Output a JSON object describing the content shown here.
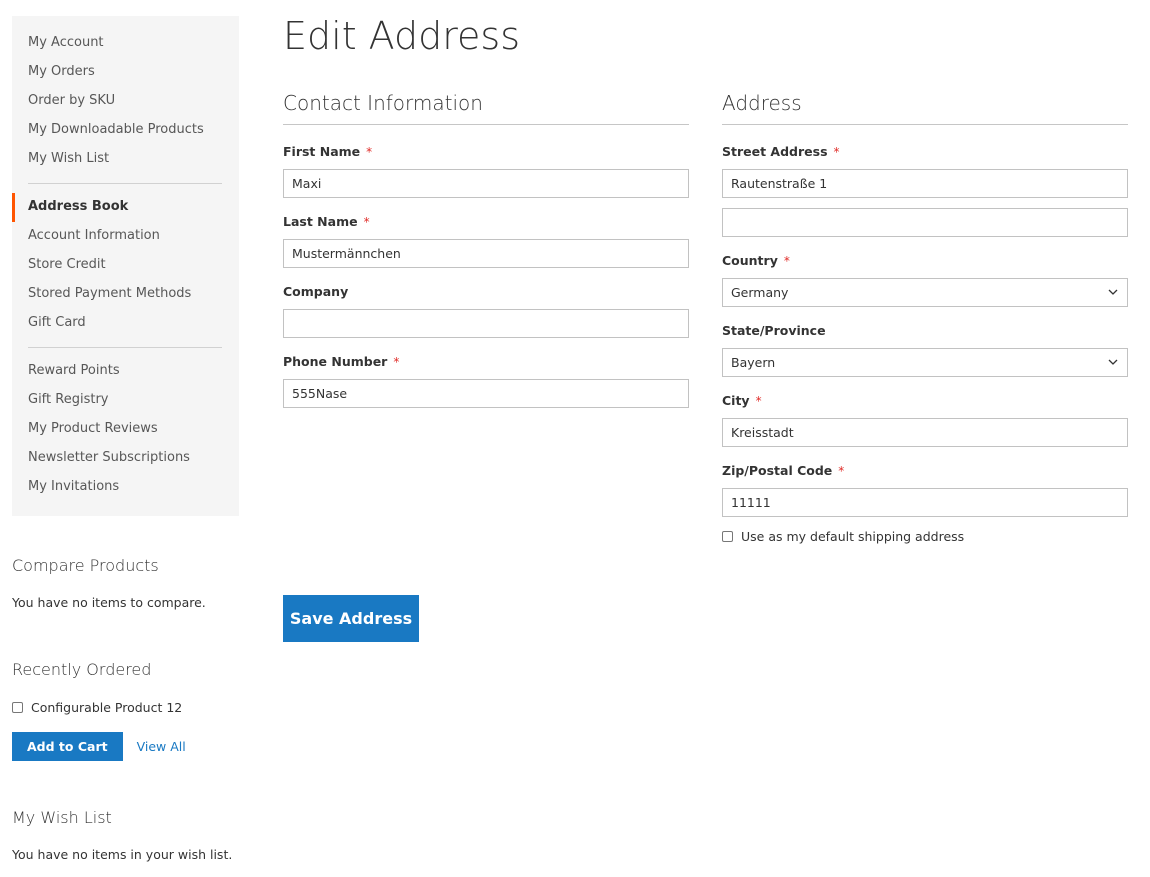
{
  "sidebar": {
    "group1": [
      "My Account",
      "My Orders",
      "Order by SKU",
      "My Downloadable Products",
      "My Wish List"
    ],
    "group2": [
      "Address Book",
      "Account Information",
      "Store Credit",
      "Stored Payment Methods",
      "Gift Card"
    ],
    "group3": [
      "Reward Points",
      "Gift Registry",
      "My Product Reviews",
      "Newsletter Subscriptions",
      "My Invitations"
    ],
    "current": "Address Book",
    "current_color": "#ff5501"
  },
  "compare": {
    "title": "Compare Products",
    "empty_text": "You have no items to compare."
  },
  "recent": {
    "title": "Recently Ordered",
    "item": "Configurable Product 12",
    "add_to_cart": "Add to Cart",
    "view_all": "View All"
  },
  "wishlist": {
    "title": "My Wish List",
    "empty_text": "You have no items in your wish list."
  },
  "page": {
    "title": "Edit Address"
  },
  "contact": {
    "legend": "Contact Information",
    "first_name_label": "First Name",
    "first_name_value": "Maxi",
    "last_name_label": "Last Name",
    "last_name_value": "Mustermännchen",
    "company_label": "Company",
    "company_value": "",
    "phone_label": "Phone Number",
    "phone_value": "555Nase"
  },
  "address": {
    "legend": "Address",
    "street_label": "Street Address",
    "street_line1": "Rautenstraße 1",
    "street_line2": "",
    "country_label": "Country",
    "country_value": "Germany",
    "state_label": "State/Province",
    "state_value": "Bayern",
    "city_label": "City",
    "city_value": "Kreisstadt",
    "zip_label": "Zip/Postal Code",
    "zip_value": "11111",
    "default_shipping_label": "Use as my default shipping address"
  },
  "actions": {
    "save": "Save Address"
  },
  "required_marker": "*",
  "colors": {
    "primary": "#1979c3",
    "required": "#e02b27"
  }
}
